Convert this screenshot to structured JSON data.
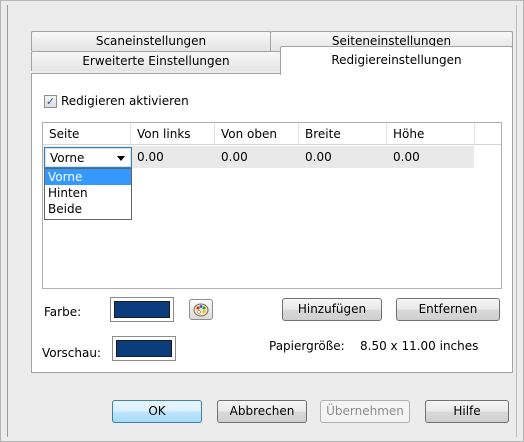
{
  "tabs": {
    "row1": [
      "Scaneinstellungen",
      "Seiteneinstellungen"
    ],
    "row2": [
      "Erweiterte Einstellungen",
      "Redigiereinstellungen"
    ],
    "active": "Redigiereinstellungen"
  },
  "redact": {
    "enable_label": "Redigieren aktivieren",
    "enabled": true,
    "check_glyph": "✓"
  },
  "grid": {
    "headers": [
      "Seite",
      "Von links",
      "Von oben",
      "Breite",
      "Höhe"
    ],
    "rows": [
      {
        "seite": "Vorne",
        "von_links": "0.00",
        "von_oben": "0.00",
        "breite": "0.00",
        "hoehe": "0.00"
      }
    ],
    "dropdown_options": [
      "Vorne",
      "Hinten",
      "Beide"
    ],
    "dropdown_selected": "Vorne"
  },
  "color": {
    "label": "Farbe:",
    "value": "#0b3c7e",
    "palette_icon": "palette-icon"
  },
  "preview": {
    "label": "Vorschau:"
  },
  "buttons": {
    "add": "Hinzufügen",
    "remove": "Entfernen",
    "ok": "OK",
    "cancel": "Abbrechen",
    "apply": "Übernehmen",
    "help": "Hilfe"
  },
  "paper": {
    "label": "Papiergröße:",
    "value": "8.50 x 11.00 inches"
  }
}
